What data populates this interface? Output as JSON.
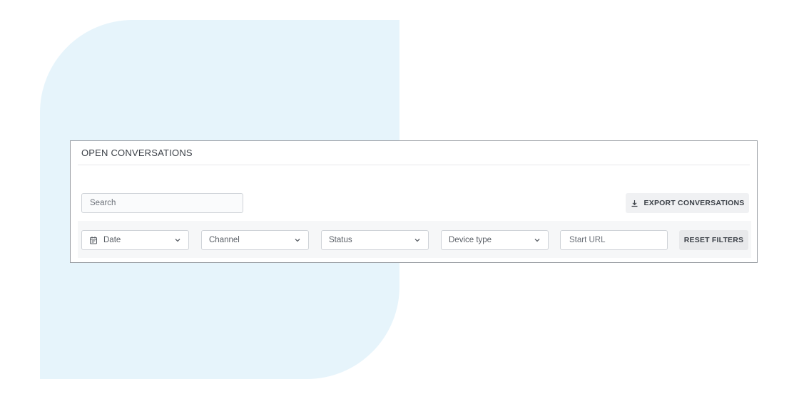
{
  "panel": {
    "title": "OPEN CONVERSATIONS"
  },
  "search": {
    "placeholder": "Search"
  },
  "export": {
    "label": "EXPORT CONVERSATIONS",
    "icon": "download-icon"
  },
  "filters": {
    "date": {
      "label": "Date",
      "icon": "calendar-icon"
    },
    "channel": {
      "label": "Channel"
    },
    "status": {
      "label": "Status"
    },
    "device_type": {
      "label": "Device type"
    },
    "start_url": {
      "placeholder": "Start URL"
    },
    "reset_label": "RESET FILTERS"
  },
  "colors": {
    "background_shape": "#e6f4fb",
    "panel_border": "#9a9ea4",
    "filter_bar": "#f6f7f8",
    "button_bg": "#f0f1f3",
    "text": "#3c4148"
  }
}
